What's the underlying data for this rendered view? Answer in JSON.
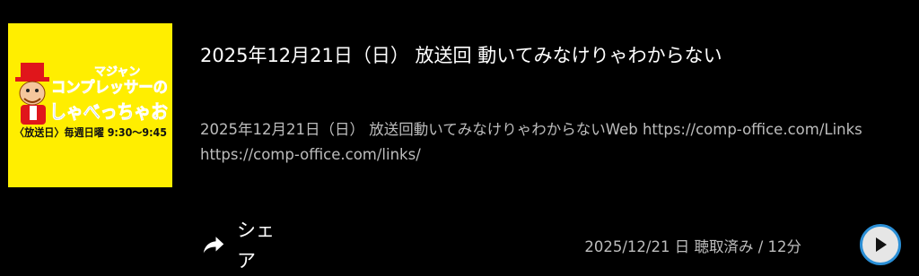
{
  "episode": {
    "thumbnail": {
      "top_text": "マジャン",
      "title_line1": "コンプレッサーの",
      "title_line2": "しゃべっちゃお",
      "schedule": "〈放送日〉毎週日曜 9:30～9:45",
      "background": "#ffee00"
    },
    "title": "2025年12月21日（日） 放送回 動いてみなけりゃわからない",
    "description_line1": "2025年12月21日（日） 放送回動いてみなけりゃわからないWeb https://comp-office.com/Links",
    "description_line2": "https://comp-office.com/links/",
    "share_label": "シェア",
    "share_icon": "share-arrow-icon",
    "meta": "2025/12/21 日 聴取済み / 12分",
    "play_icon": "play-icon",
    "accent_color": "#2b8fd6"
  }
}
